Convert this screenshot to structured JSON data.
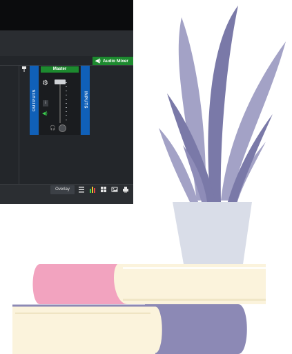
{
  "mixer_panel": {
    "tab_label": "Audio Mixer",
    "channel_name": "Master",
    "outputs_label": "OUTPUTS",
    "inputs_label": "INPUTS",
    "info_label": "i"
  },
  "statusbar": {
    "overlay_label": "Overlay"
  },
  "icons": [
    "speaker-icon",
    "gear-icon",
    "pin-icon",
    "headphones-icon",
    "list-icon",
    "meter-icon",
    "grid-icon",
    "image-icon",
    "print-icon"
  ],
  "colors": {
    "accent_green": "#1d8a2f",
    "accent_blue": "#1060b8",
    "app_background": "#1f2226",
    "plant_leaf_dark": "#7a79a8",
    "plant_leaf_light": "#a3a2c6",
    "pot": "#d9dde8",
    "book_pink": "#f2a3bf",
    "book_cream": "#fbf3dc",
    "book_purple": "#8c89b5"
  }
}
